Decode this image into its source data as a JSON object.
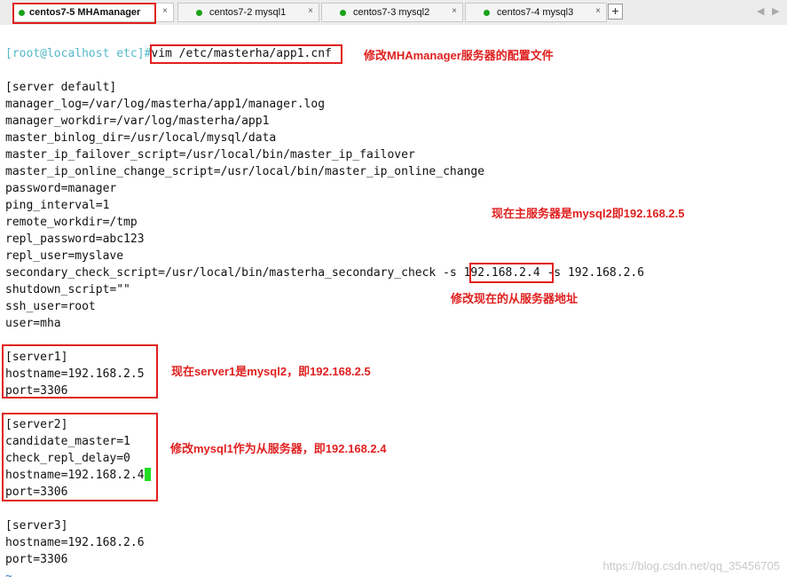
{
  "tabs": [
    {
      "label": "centos7-5 MHAmanager",
      "close": "×",
      "active": true
    },
    {
      "label": "centos7-2 mysql1",
      "close": "×",
      "active": false
    },
    {
      "label": "centos7-3 mysql2",
      "close": "×",
      "active": false
    },
    {
      "label": "centos7-4 mysql3",
      "close": "×",
      "active": false
    }
  ],
  "tab_controls": {
    "add": "+",
    "prev": "◀",
    "next": "▶"
  },
  "terminal": {
    "prompt": "[root@localhost etc]#",
    "command": "vim /etc/masterha/app1.cnf",
    "lines": [
      "[server default]",
      "manager_log=/var/log/masterha/app1/manager.log",
      "manager_workdir=/var/log/masterha/app1",
      "master_binlog_dir=/usr/local/mysql/data",
      "master_ip_failover_script=/usr/local/bin/master_ip_failover",
      "master_ip_online_change_script=/usr/local/bin/master_ip_online_change",
      "password=manager",
      "ping_interval=1",
      "remote_workdir=/tmp",
      "repl_password=abc123",
      "repl_user=myslave",
      "secondary_check_script=/usr/local/bin/masterha_secondary_check -s ",
      "192.168.2.4",
      " -s 192.168.2.6",
      "shutdown_script=\"\"",
      "ssh_user=root",
      "user=mha",
      "[server1]",
      "hostname=192.168.2.5",
      "port=3306",
      "[server2]",
      "candidate_master=1",
      "check_repl_delay=0",
      "hostname=192.168.2.4",
      "port=3306",
      "[server3]",
      "hostname=192.168.2.6",
      "port=3306",
      "~"
    ]
  },
  "annotations": {
    "edit_config": "修改MHAmanager服务器的配置文件",
    "current_master": "现在主服务器是mysql2即192.168.2.5",
    "edit_slave": "修改现在的从服务器地址",
    "server1_note": "现在server1是mysql2，即192.168.2.5",
    "server2_note": "修改mysql1作为从服务器，即192.168.2.4"
  },
  "watermark": "https://blog.csdn.net/qq_35456705",
  "colors": {
    "annotation": "#e02020",
    "prompt": "#55b8c8",
    "cursor": "#22dd22",
    "tab_dot": "#1aa31a"
  }
}
